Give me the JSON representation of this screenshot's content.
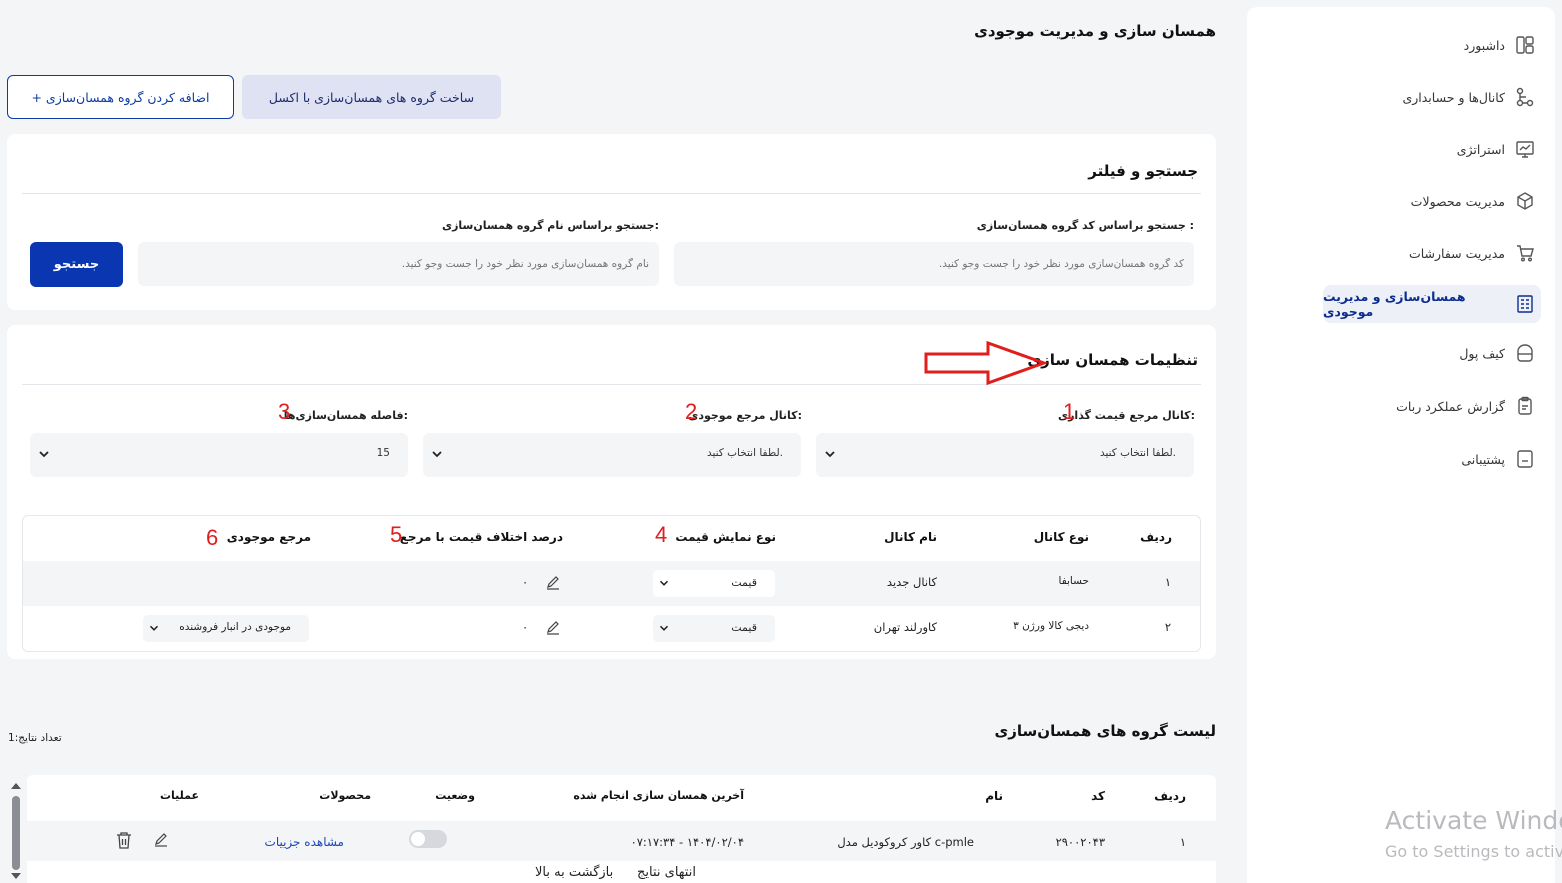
{
  "sidebar": {
    "items": [
      {
        "label": "داشبورد",
        "icon": "dashboard-icon"
      },
      {
        "label": "کانال‌ها و حسابداری",
        "icon": "channels-icon"
      },
      {
        "label": "استراتژی",
        "icon": "strategy-icon"
      },
      {
        "label": "مدیریت محصولات",
        "icon": "box-icon"
      },
      {
        "label": "مدیریت سفارشات",
        "icon": "cart-icon"
      },
      {
        "label": "همسان‌سازی و مدیریت موجودی",
        "icon": "sync-icon",
        "active": true
      },
      {
        "label": "کیف پول",
        "icon": "wallet-icon"
      },
      {
        "label": "گزارش عملکرد ربات",
        "icon": "report-icon"
      },
      {
        "label": "پشتیبانی",
        "icon": "support-icon"
      }
    ],
    "active_color": "#0c2d8f"
  },
  "header": {
    "title": "همسان سازی و مدیریت موجودی",
    "add_group_label": "+ اضافه کردن گروه همسان‌سازی",
    "excel_label": "ساخت گروه های همسان‌سازی با اکسل"
  },
  "search": {
    "title": "جستجو و فیلتر",
    "code_label": "جستجو براساس کد گروه همسان‌سازی :",
    "code_placeholder": "کد گروه همسان‌سازی مورد نظر خود را جست وجو کنید.",
    "name_label": "جستجو براساس نام گروه همسان‌سازی:",
    "name_placeholder": "نام گروه همسان‌سازی مورد نظر خود را جست وجو کنید.",
    "button": "جستجو"
  },
  "settings": {
    "title": "تنظیمات همسان سازی",
    "price_ref_label": "کانال مرجع قیمت گذاری:",
    "price_ref_value": "لطفا انتخاب کنید.",
    "stock_ref_label": "کانال مرجع موجودی:",
    "stock_ref_value": "لطفا انتخاب کنید.",
    "interval_label": "فاصله همسان‌سازی‌ها:",
    "interval_value": "15",
    "markers": [
      "1",
      "2",
      "3",
      "4",
      "5",
      "6"
    ],
    "table": {
      "headers": {
        "row": "ردیف",
        "channel_type": "نوع کانال",
        "channel_name": "نام کانال",
        "price_display": "نوع نمایش قیمت",
        "price_diff": "درصد اختلاف قیمت با مرجع",
        "stock_ref": "مرجع موجودی"
      },
      "rows": [
        {
          "row": "۱",
          "channel_type": "حسابفا",
          "channel_name": "کانال جدید",
          "price_display": "قیمت",
          "price_diff": "۰",
          "stock_ref": ""
        },
        {
          "row": "۲",
          "channel_type": "دیجی کالا ورژن ۳",
          "channel_name": "کاورلند تهران",
          "price_display": "قیمت",
          "price_diff": "۰",
          "stock_ref": "موجودی در انبار فروشنده"
        }
      ]
    }
  },
  "list": {
    "title": "لیست گروه های همسان‌سازی",
    "count_label": "تعداد نتایج:1",
    "headers": {
      "row": "ردیف",
      "code": "کد",
      "name": "نام",
      "last_sync": "آخرین همسان سازی انجام شده",
      "status": "وضعیت",
      "products": "محصولات",
      "actions": "عملیات"
    },
    "rows": [
      {
        "row": "۱",
        "code": "۲۹۰۰۲۰۴۳",
        "name": "کاور کروکودیل مدل c-pmle",
        "last_sync": "۰۷:۱۷:۳۴ - ۱۴۰۴/۰۲/۰۴",
        "status_on": false,
        "products_link": "مشاهده جزییات"
      }
    ],
    "end_text": "انتهای نتایج",
    "back_top": "بازگشت به بالا"
  },
  "watermark": {
    "line1": "Activate Window",
    "line2": "Go to Settings to activ"
  }
}
